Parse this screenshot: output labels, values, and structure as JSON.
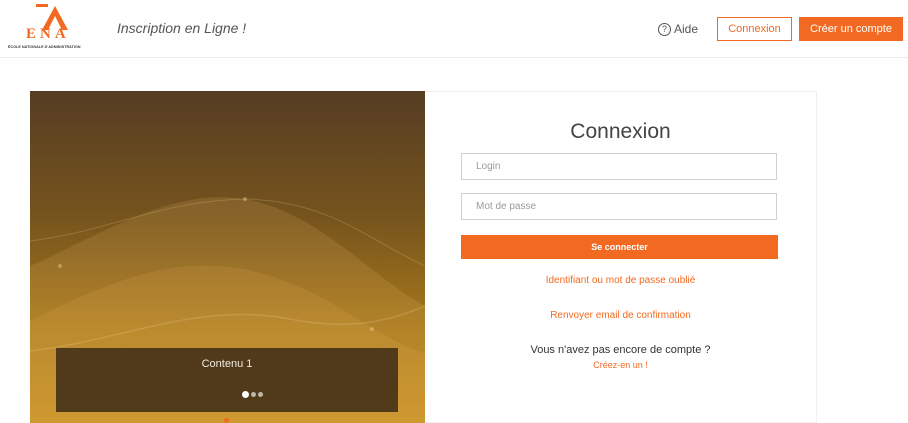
{
  "header": {
    "logo": {
      "letters": "ENA",
      "subtitle": "ÉCOLE NATIONALE D'ADMINISTRATION"
    },
    "site_title": "Inscription en Ligne !",
    "help": {
      "icon": "question-circle-icon",
      "label": "Aide"
    },
    "login_button": "Connexion",
    "signup_button": "Créer un compte"
  },
  "carousel": {
    "caption": "Contenu 1",
    "slide_count": 3,
    "active_slide": 1
  },
  "login": {
    "title": "Connexion",
    "login_placeholder": "Login",
    "password_placeholder": "Mot de passe",
    "submit": "Se connecter",
    "forgot_link": "Identifiant ou mot de passe oublié",
    "resend_link": "Renvoyer email de confirmation",
    "no_account_text": "Vous n'avez pas encore de compte ?",
    "create_link": "Créez-en un !"
  },
  "colors": {
    "accent": "#f26a21",
    "carousel_top": "#553d23",
    "carousel_bottom": "#c28a1f",
    "caption_bg": "#483419"
  }
}
